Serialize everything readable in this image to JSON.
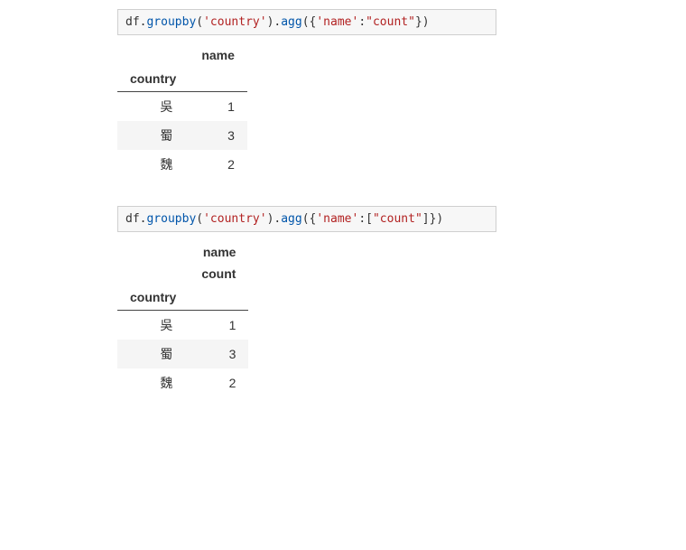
{
  "cell1": {
    "code_tokens": [
      {
        "t": "df",
        "c": "tok-var"
      },
      {
        "t": ".",
        "c": "tok-punc"
      },
      {
        "t": "groupby",
        "c": "tok-method"
      },
      {
        "t": "(",
        "c": "tok-punc"
      },
      {
        "t": "'country'",
        "c": "tok-str"
      },
      {
        "t": ")",
        "c": "tok-punc"
      },
      {
        "t": ".",
        "c": "tok-punc"
      },
      {
        "t": "agg",
        "c": "tok-method"
      },
      {
        "t": "({",
        "c": "tok-punc"
      },
      {
        "t": "'name'",
        "c": "tok-str"
      },
      {
        "t": ":",
        "c": "tok-punc"
      },
      {
        "t": "\"count\"",
        "c": "tok-str"
      },
      {
        "t": "})",
        "c": "tok-punc"
      }
    ],
    "table": {
      "col_header": "name",
      "index_name": "country",
      "rows": [
        {
          "idx": "吳",
          "val": "1"
        },
        {
          "idx": "蜀",
          "val": "3"
        },
        {
          "idx": "魏",
          "val": "2"
        }
      ]
    }
  },
  "cell2": {
    "code_tokens": [
      {
        "t": "df",
        "c": "tok-var"
      },
      {
        "t": ".",
        "c": "tok-punc"
      },
      {
        "t": "groupby",
        "c": "tok-method"
      },
      {
        "t": "(",
        "c": "tok-punc"
      },
      {
        "t": "'country'",
        "c": "tok-str"
      },
      {
        "t": ")",
        "c": "tok-punc"
      },
      {
        "t": ".",
        "c": "tok-punc"
      },
      {
        "t": "agg",
        "c": "tok-method"
      },
      {
        "t": "({",
        "c": "tok-punc"
      },
      {
        "t": "'name'",
        "c": "tok-str"
      },
      {
        "t": ":[",
        "c": "tok-punc"
      },
      {
        "t": "\"count\"",
        "c": "tok-str"
      },
      {
        "t": "]})",
        "c": "tok-punc"
      }
    ],
    "table": {
      "col_header1": "name",
      "col_header2": "count",
      "index_name": "country",
      "rows": [
        {
          "idx": "吳",
          "val": "1"
        },
        {
          "idx": "蜀",
          "val": "3"
        },
        {
          "idx": "魏",
          "val": "2"
        }
      ]
    }
  }
}
